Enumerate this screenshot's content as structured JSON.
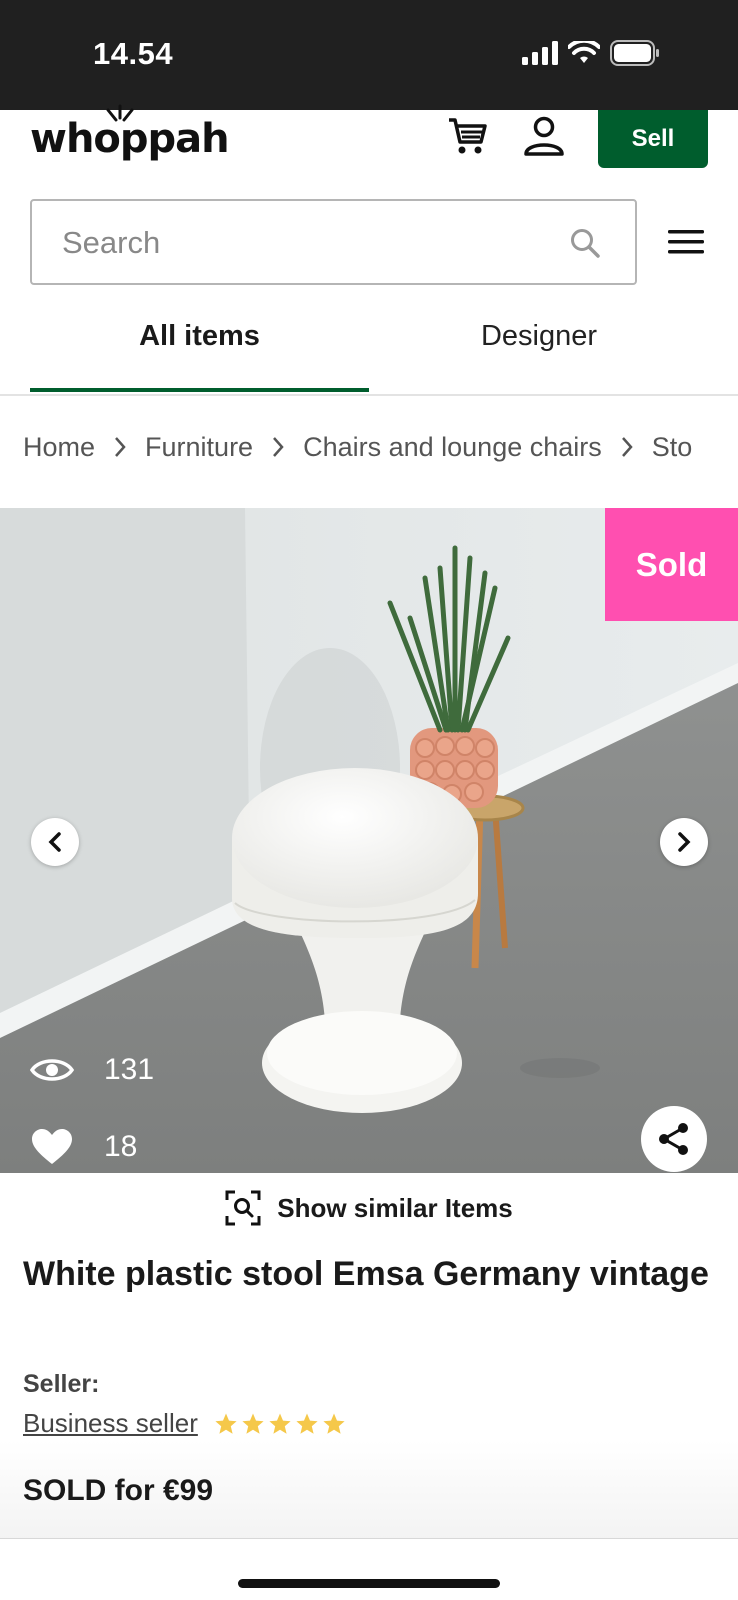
{
  "status_bar": {
    "time": "14.54"
  },
  "header": {
    "logo": "whoppah",
    "sell_label": "Sell"
  },
  "search": {
    "placeholder": "Search"
  },
  "tabs": [
    {
      "label": "All items"
    },
    {
      "label": "Designer"
    }
  ],
  "breadcrumb": [
    "Home",
    "Furniture",
    "Chairs and lounge chairs",
    "Sto"
  ],
  "gallery": {
    "sold_badge": "Sold",
    "views": "131",
    "likes": "18"
  },
  "similar": {
    "label": "Show similar Items"
  },
  "product": {
    "title": "White plastic stool Emsa Germany vintage",
    "seller_label": "Seller:",
    "seller_name": "Business seller",
    "rating": 5,
    "price": "SOLD for €99"
  },
  "colors": {
    "brand": "#005d2d",
    "sold": "#ff4fb0",
    "star": "#f5c84a"
  }
}
